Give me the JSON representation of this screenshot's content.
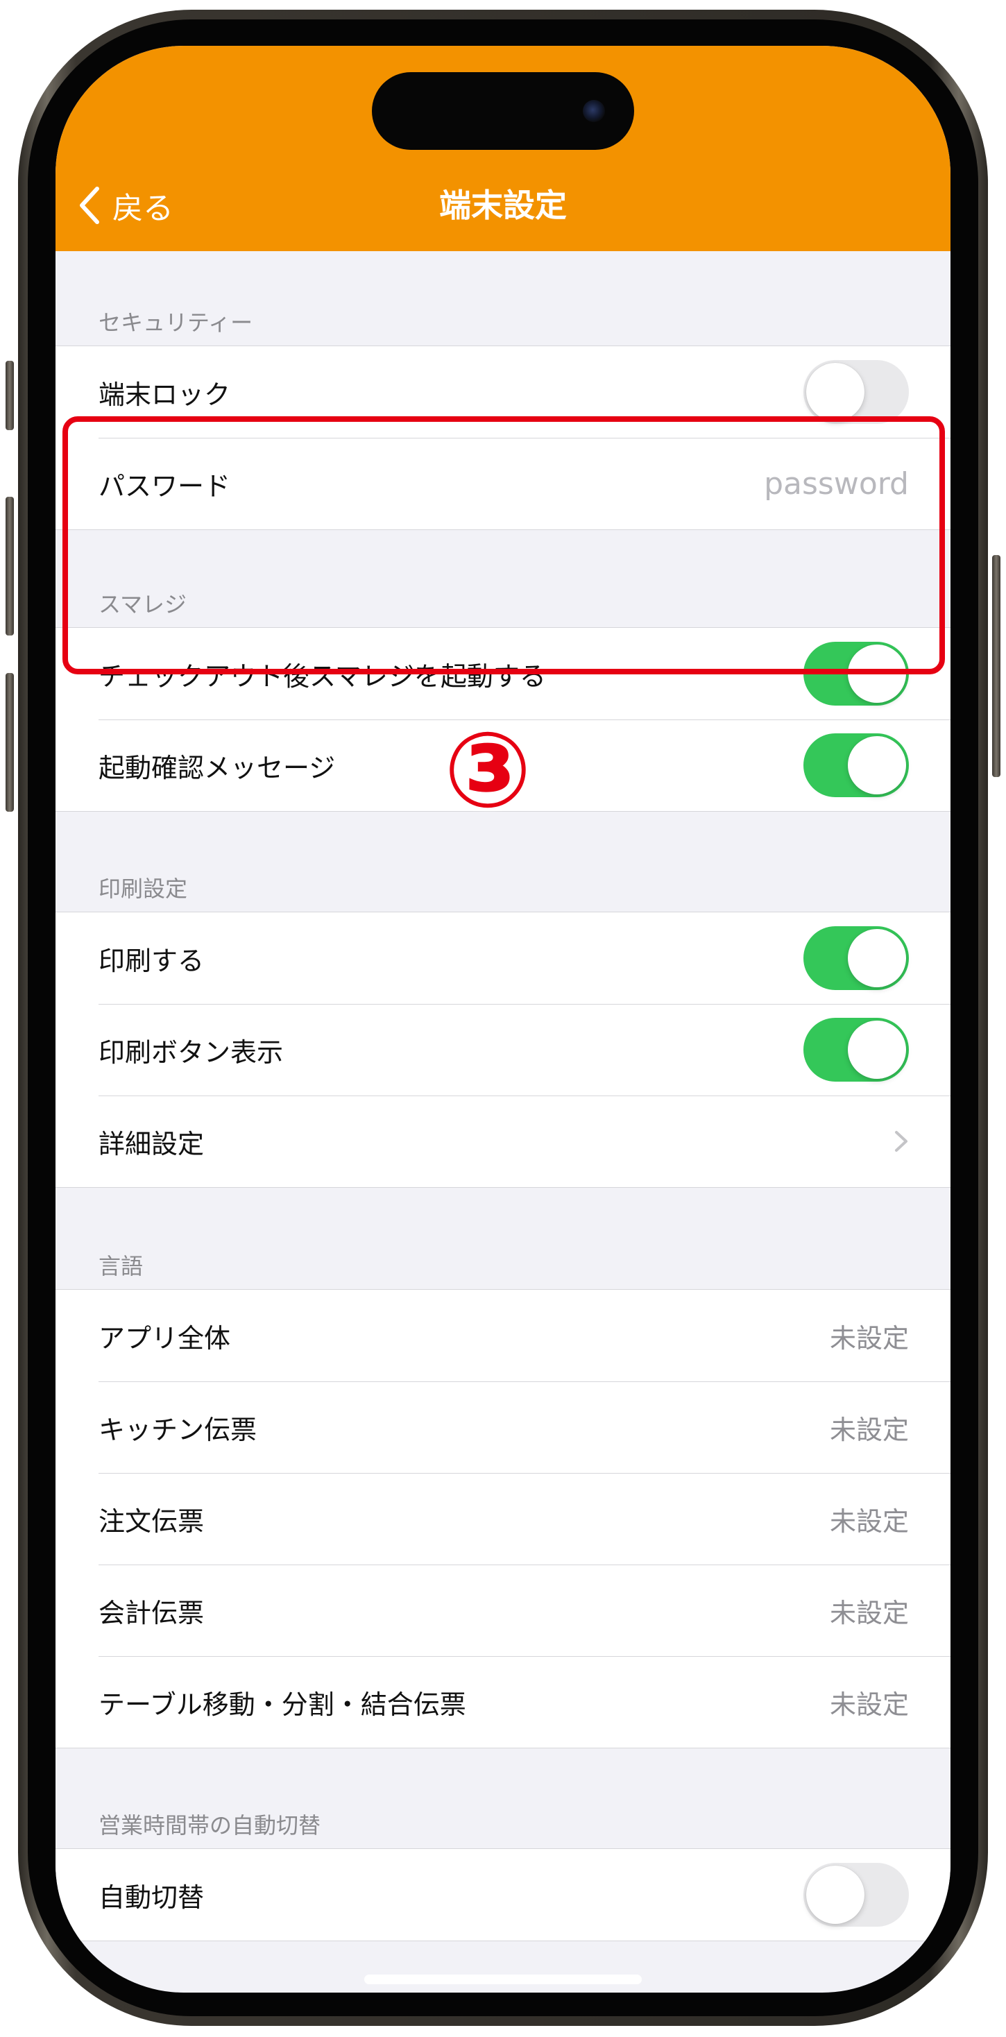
{
  "nav": {
    "back_label": "戻る",
    "title": "端末設定"
  },
  "sections": {
    "security": {
      "header": "セキュリティー",
      "lock_label": "端末ロック",
      "lock_on": false,
      "password_label": "パスワード",
      "password_placeholder": "password"
    },
    "smaregi": {
      "header": "スマレジ",
      "launch_label": "チェックアウト後スマレジを起動する",
      "launch_on": true,
      "confirm_label": "起動確認メッセージ",
      "confirm_on": true
    },
    "print": {
      "header": "印刷設定",
      "print_label": "印刷する",
      "print_on": true,
      "button_label": "印刷ボタン表示",
      "button_on": true,
      "detail_label": "詳細設定"
    },
    "language": {
      "header": "言語",
      "items": [
        {
          "label": "アプリ全体",
          "value": "未設定"
        },
        {
          "label": "キッチン伝票",
          "value": "未設定"
        },
        {
          "label": "注文伝票",
          "value": "未設定"
        },
        {
          "label": "会計伝票",
          "value": "未設定"
        },
        {
          "label": "テーブル移動・分割・結合伝票",
          "value": "未設定"
        }
      ]
    },
    "auto_switch": {
      "header": "営業時間帯の自動切替",
      "label": "自動切替",
      "on": false
    }
  },
  "annotation": {
    "number": "③"
  },
  "colors": {
    "header_orange": "#f39200",
    "toggle_on": "#34c759",
    "toggle_off": "#e9e9eb",
    "annotation_red": "#e60012",
    "background": "#f2f2f7"
  }
}
